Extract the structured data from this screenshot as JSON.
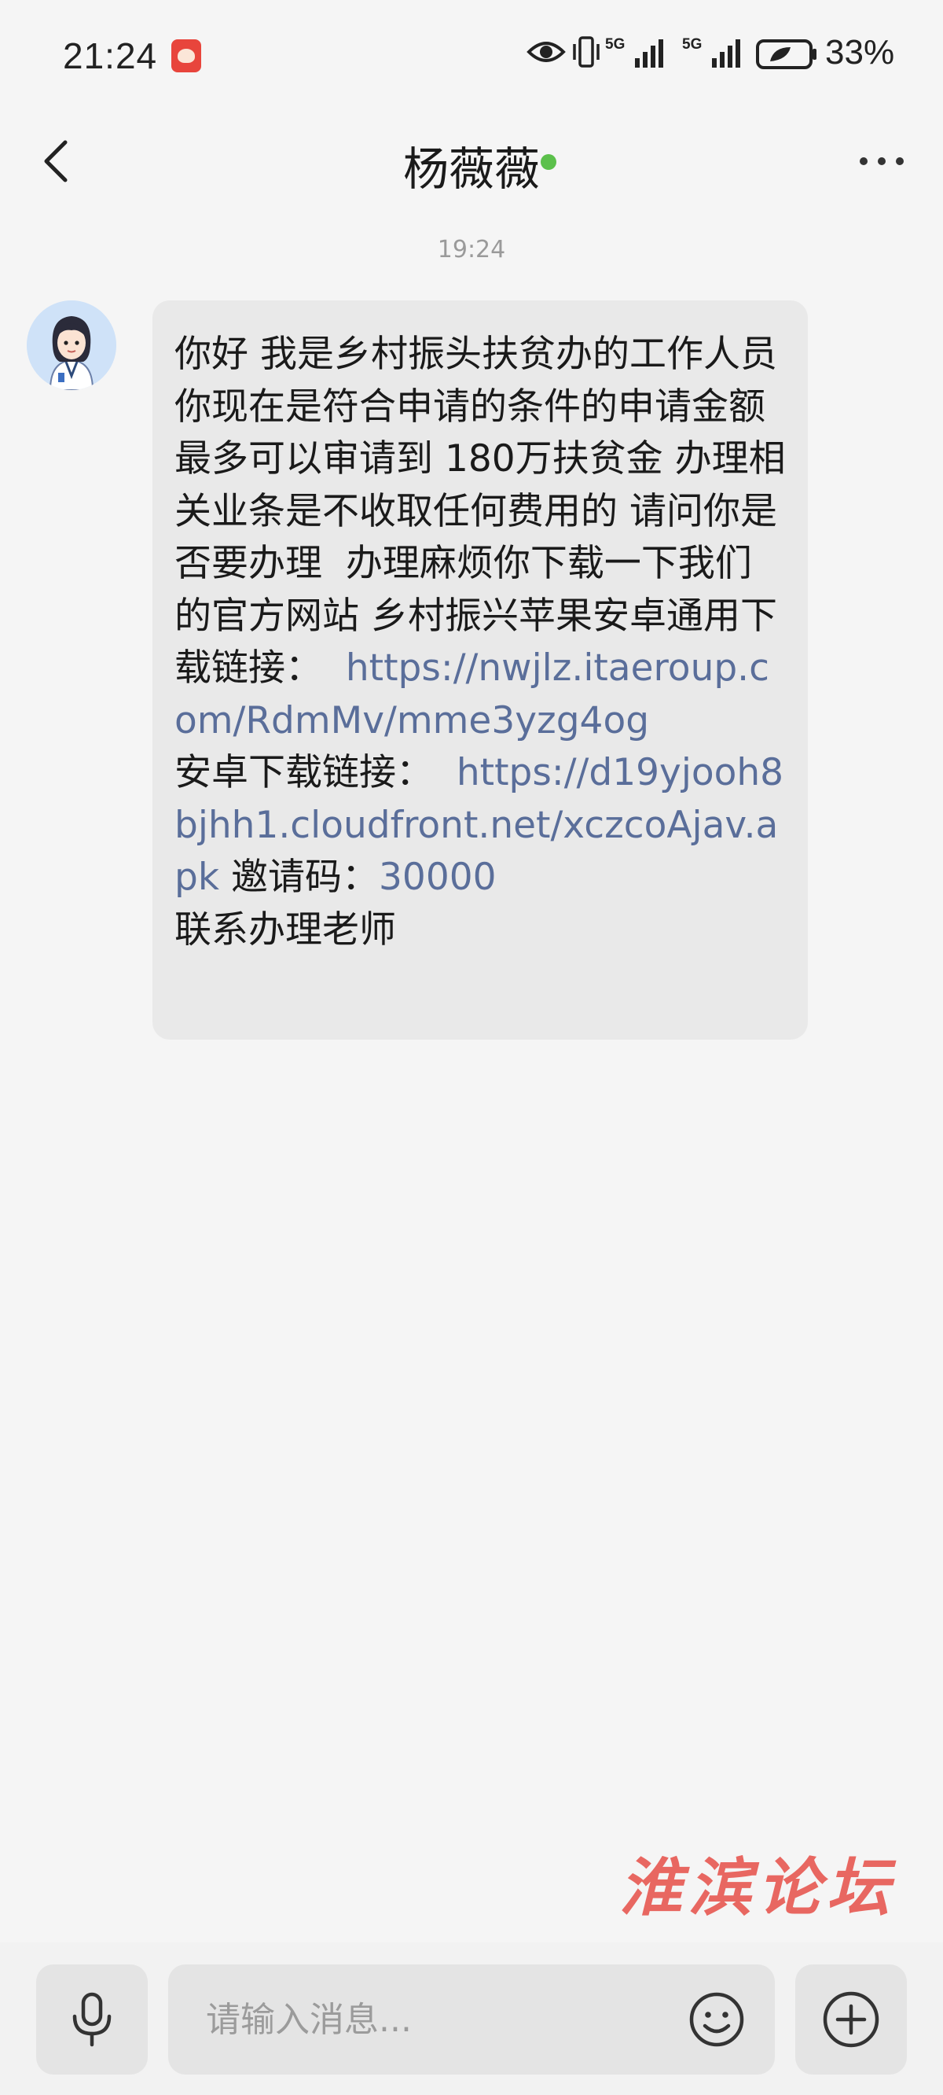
{
  "status_bar": {
    "time": "21:24",
    "battery_percent": "33%",
    "network_1": "5G",
    "network_2": "5G",
    "icons": [
      "app-notification-icon",
      "eye-icon",
      "vibrate-icon",
      "signal-icon",
      "signal-icon",
      "battery-icon"
    ]
  },
  "header": {
    "contact_name": "杨薇薇",
    "online_status_color": "#5bc04b",
    "back_icon": "chevron-left-icon",
    "more_icon": "more-dots-icon"
  },
  "conversation": {
    "timestamp": "19:24",
    "messages": [
      {
        "sender": "received",
        "parts": [
          {
            "text": "你好 我是乡村振头扶贫办的工作人员 你现在是符合申请的条件的申请金额最多可以审请到 180万扶贫金 办理相关业条是不收取任何费用的 请问你是否要办理  办理麻烦你下载一下我们的官方网站 乡村振兴苹果安卓通用下载链接：  ",
            "link": false
          },
          {
            "text": "https://nwjlz.itaeroup.com/RdmMv/mme3yzg4og",
            "link": true
          },
          {
            "text": "\n安卓下载链接：  ",
            "link": false
          },
          {
            "text": "https://d19yjooh8bjhh1.cloudfront.net/xczcoAjav.apk",
            "link": true
          },
          {
            "text": " 邀请码：",
            "link": false
          },
          {
            "text": "30000",
            "link": true
          },
          {
            "text": "\n联系办理老师",
            "link": false
          }
        ]
      }
    ]
  },
  "watermark": "淮滨论坛",
  "input_bar": {
    "placeholder": "请输入消息...",
    "voice_icon": "microphone-icon",
    "emoji_icon": "smiley-icon",
    "plus_icon": "plus-circle-icon"
  },
  "colors": {
    "background": "#f5f5f5",
    "bubble": "#e9e9e9",
    "link": "#5a6e9a",
    "online_dot": "#5bc04b",
    "watermark": "#e8605a"
  }
}
